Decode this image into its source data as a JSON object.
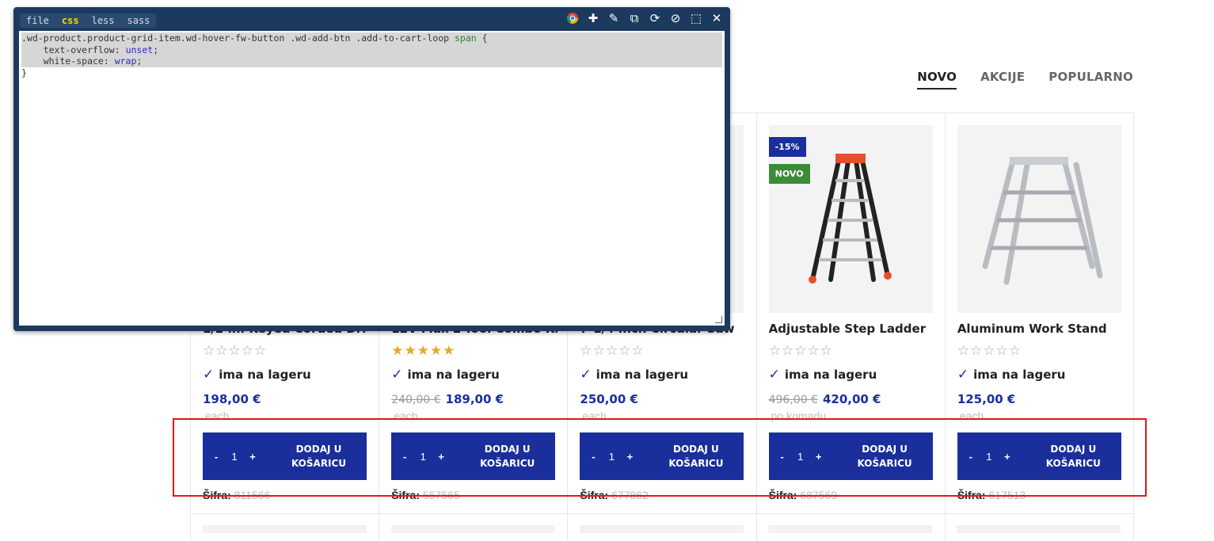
{
  "tabs": [
    {
      "label": "NOVO",
      "active": true
    },
    {
      "label": "AKCIJE",
      "active": false
    },
    {
      "label": "POPULARNO",
      "active": false
    }
  ],
  "products": [
    {
      "title": "1/2 in. Keyed Corded Dri",
      "rating": 0,
      "stock": "ima na lageru",
      "old_price": "",
      "price": "198,00 €",
      "unit": "each",
      "qty": "1",
      "add_label": "DODAJ U KOŠARICU",
      "sku_label": "Šifra:",
      "sku": "811566"
    },
    {
      "title": "12V Max 2-Tool Combo Kit",
      "rating": 5,
      "stock": "ima na lageru",
      "old_price": "240,00 €",
      "price": "189,00 €",
      "unit": "each",
      "qty": "1",
      "add_label": "DODAJ U KOŠARICU",
      "sku_label": "Šifra:",
      "sku": "557565"
    },
    {
      "title": "7-1/4 Inch Circular Saw",
      "rating": 0,
      "stock": "ima na lageru",
      "old_price": "",
      "price": "250,00 €",
      "unit": "each",
      "qty": "1",
      "add_label": "DODAJ U KOŠARICU",
      "sku_label": "Šifra:",
      "sku": "677862"
    },
    {
      "title": "Adjustable Step Ladder",
      "rating": 0,
      "stock": "ima na lageru",
      "old_price": "496,00 €",
      "price": "420,00 €",
      "unit": "po komadu",
      "qty": "1",
      "add_label": "DODAJ U KOŠARICU",
      "sku_label": "Šifra:",
      "sku": "687569",
      "badges": {
        "sale": "-15%",
        "new": "NOVO"
      }
    },
    {
      "title": "Aluminum Work Stand",
      "rating": 0,
      "stock": "ima na lageru",
      "old_price": "",
      "price": "125,00 €",
      "unit": "each",
      "qty": "1",
      "add_label": "DODAJ U KOŠARICU",
      "sku_label": "Šifra:",
      "sku": "617513"
    }
  ],
  "qty_minus": "-",
  "qty_plus": "+",
  "editor": {
    "tabs": [
      {
        "label": "file",
        "active": false
      },
      {
        "label": "css",
        "active": true
      },
      {
        "label": "less",
        "active": false
      },
      {
        "label": "sass",
        "active": false
      }
    ],
    "icons": [
      "chrome-icon",
      "plus-icon",
      "pin-icon",
      "popout-icon",
      "refresh-icon",
      "disable-icon",
      "select-icon",
      "close-icon"
    ],
    "code": {
      "line1_selector": ".wd-product.product-grid-item.wd-hover-fw-button .wd-add-btn .add-to-cart-loop ",
      "line1_tag": "span",
      "line1_brace": " {",
      "line2_prop": "    text-overflow: ",
      "line2_val": "unset",
      "line3_prop": "    white-space: ",
      "line3_val": "wrap",
      "line4": "}"
    }
  },
  "colors": {
    "accent": "#1a2f9b",
    "new_badge": "#3d8b37",
    "highlight": "#e01818",
    "editor_frame": "#1c3a5e"
  }
}
